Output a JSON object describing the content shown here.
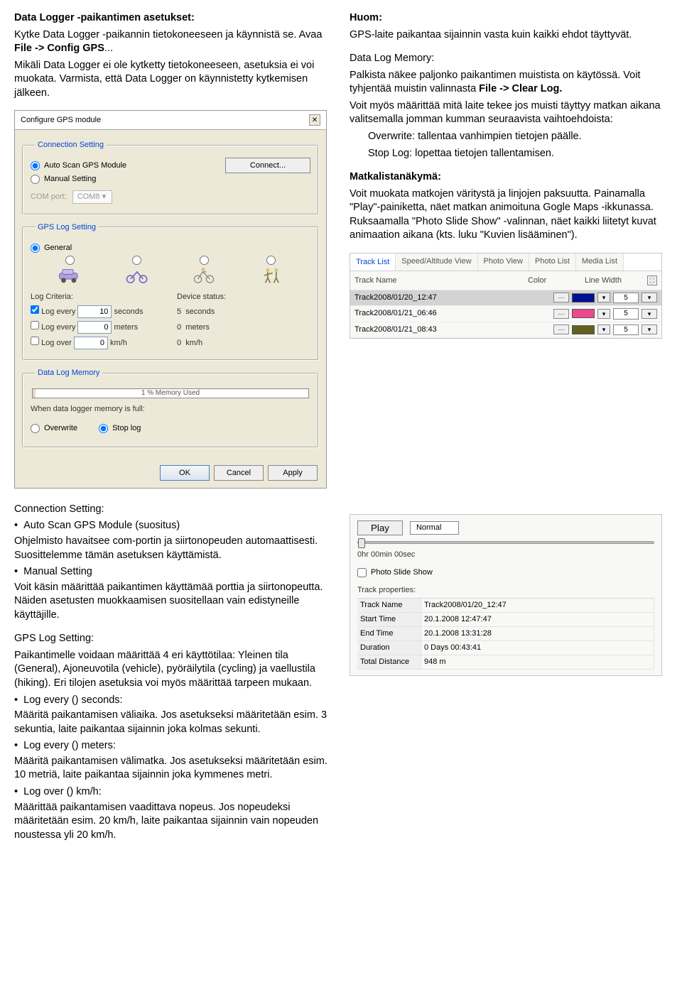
{
  "intro": {
    "title": "Data Logger -paikantimen asetukset:",
    "p1a": "Kytke Data Logger -paikannin tietokoneeseen ja käynnistä se. Avaa ",
    "p1b": "File -> Config GPS",
    "p1c": "...",
    "p2": "Mikäli Data Logger ei ole kytketty tietokoneeseen, asetuksia ei voi muokata. Varmista, että Data Logger on käynnistetty kytkemisen jälkeen."
  },
  "huom": {
    "title": "Huom:",
    "text": "GPS-laite paikantaa sijainnin vasta kuin kaikki ehdot täyttyvät."
  },
  "dlm": {
    "title": "Data Log Memory:",
    "p1a": "Palkista näkee paljonko paikantimen muistista on käytössä. Voit tyhjentää muistin valinnasta ",
    "p1b": "File -> Clear Log.",
    "p2": "Voit myös määrittää mitä laite tekee jos muisti täyttyy matkan aikana valitsemalla jomman kumman seuraavista vaihtoehdoista:",
    "o1": "Overwrite: tallentaa vanhimpien tietojen päälle.",
    "o2": "Stop Log: lopettaa tietojen tallentamisen."
  },
  "ml": {
    "title": "Matkalistanäkymä:",
    "p": "Voit muokata matkojen väritystä ja linjojen paksuutta. Painamalla \"Play\"-painiketta, näet matkan animoituna Gogle Maps -ikkunassa. Ruksaamalla \"Photo Slide Show\" -valinnan, näet kaikki liitetyt kuvat animaation aikana (kts. luku \"Kuvien lisääminen\")."
  },
  "dialog": {
    "title": "Configure GPS module",
    "close": "✕",
    "connLegend": "Connection Setting",
    "autoScan": "Auto Scan GPS Module",
    "manual": "Manual Setting",
    "connect": "Connect...",
    "comport": "COM port:",
    "comval": "COM8",
    "logLegend": "GPS Log Setting",
    "general": "General",
    "logCriteria": "Log Criteria:",
    "deviceStatus": "Device status:",
    "le_sec": "Log every",
    "le_sec_v": "10",
    "seconds": "seconds",
    "ds_sec": "5",
    "le_m": "Log every",
    "le_m_v": "0",
    "meters": "meters",
    "ds_m": "0",
    "lo": "Log over",
    "lo_v": "0",
    "kmh": "km/h",
    "ds_kmh": "0",
    "memLegend": "Data Log Memory",
    "memText": "1 % Memory Used",
    "whenFull": "When data logger memory is full:",
    "overwrite": "Overwrite",
    "stoplog": "Stop log",
    "ok": "OK",
    "cancel": "Cancel",
    "apply": "Apply"
  },
  "tabs": [
    "Track List",
    "Speed/Altitude View",
    "Photo View",
    "Photo List",
    "Media List"
  ],
  "tlhead": {
    "name": "Track Name",
    "color": "Color",
    "lw": "Line Width"
  },
  "tracks": [
    {
      "name": "Track2008/01/20_12:47",
      "sw": "sw-navy",
      "lw": "5"
    },
    {
      "name": "Track2008/01/21_06:46",
      "sw": "sw-pink",
      "lw": "5"
    },
    {
      "name": "Track2008/01/21_08:43",
      "sw": "sw-olive",
      "lw": "5"
    }
  ],
  "player": {
    "play": "Play",
    "speed": "Normal",
    "time": "0hr 00min 00sec",
    "pss": "Photo Slide Show",
    "tprop": "Track properties:",
    "f": {
      "tn": "Track Name",
      "tnv": "Track2008/01/20_12:47",
      "st": "Start Time",
      "stv": "20.1.2008 12:47:47",
      "et": "End Time",
      "etv": "20.1.2008 13:31:28",
      "d": "Duration",
      "dv": "0 Days  00:43:41",
      "td": "Total Distance",
      "tdv": "948 m"
    }
  },
  "cs": {
    "title": "Connection Setting:",
    "b1": "Auto Scan GPS Module (suositus)",
    "b1t": "Ohjelmisto havaitsee com-portin ja siirtonopeuden automaattisesti. Suosittelemme tämän asetuksen käyttämistä.",
    "b2": "Manual Setting",
    "b2t": "Voit käsin määrittää paikantimen käyttämää porttia ja siirtonopeutta. Näiden asetusten muokkaamisen suositellaan vain edistyneille käyttäjille."
  },
  "gls": {
    "title": "GPS Log Setting:",
    "intro": "Paikantimelle voidaan määrittää 4 eri käyttötilaa: Yleinen tila (General), Ajoneuvotila (vehicle), pyöräilytila (cycling) ja vaellustila (hiking). Eri tilojen asetuksia voi myös määrittää tarpeen mukaan.",
    "b1": "Log every () seconds:",
    "b1t": "Määritä paikantamisen väliaika. Jos asetukseksi määritetään esim. 3 sekuntia, laite paikantaa sijainnin joka kolmas sekunti.",
    "b2": "Log every () meters:",
    "b2t": "Määritä paikantamisen välimatka. Jos asetukseksi määritetään esim. 10 metriä, laite paikantaa sijainnin joka kymmenes metri.",
    "b3": "Log over () km/h:",
    "b3t": "Määrittää paikantamisen vaadittava nopeus. Jos nopeudeksi määritetään esim. 20 km/h, laite paikantaa sijainnin vain nopeuden noustessa yli 20 km/h."
  }
}
